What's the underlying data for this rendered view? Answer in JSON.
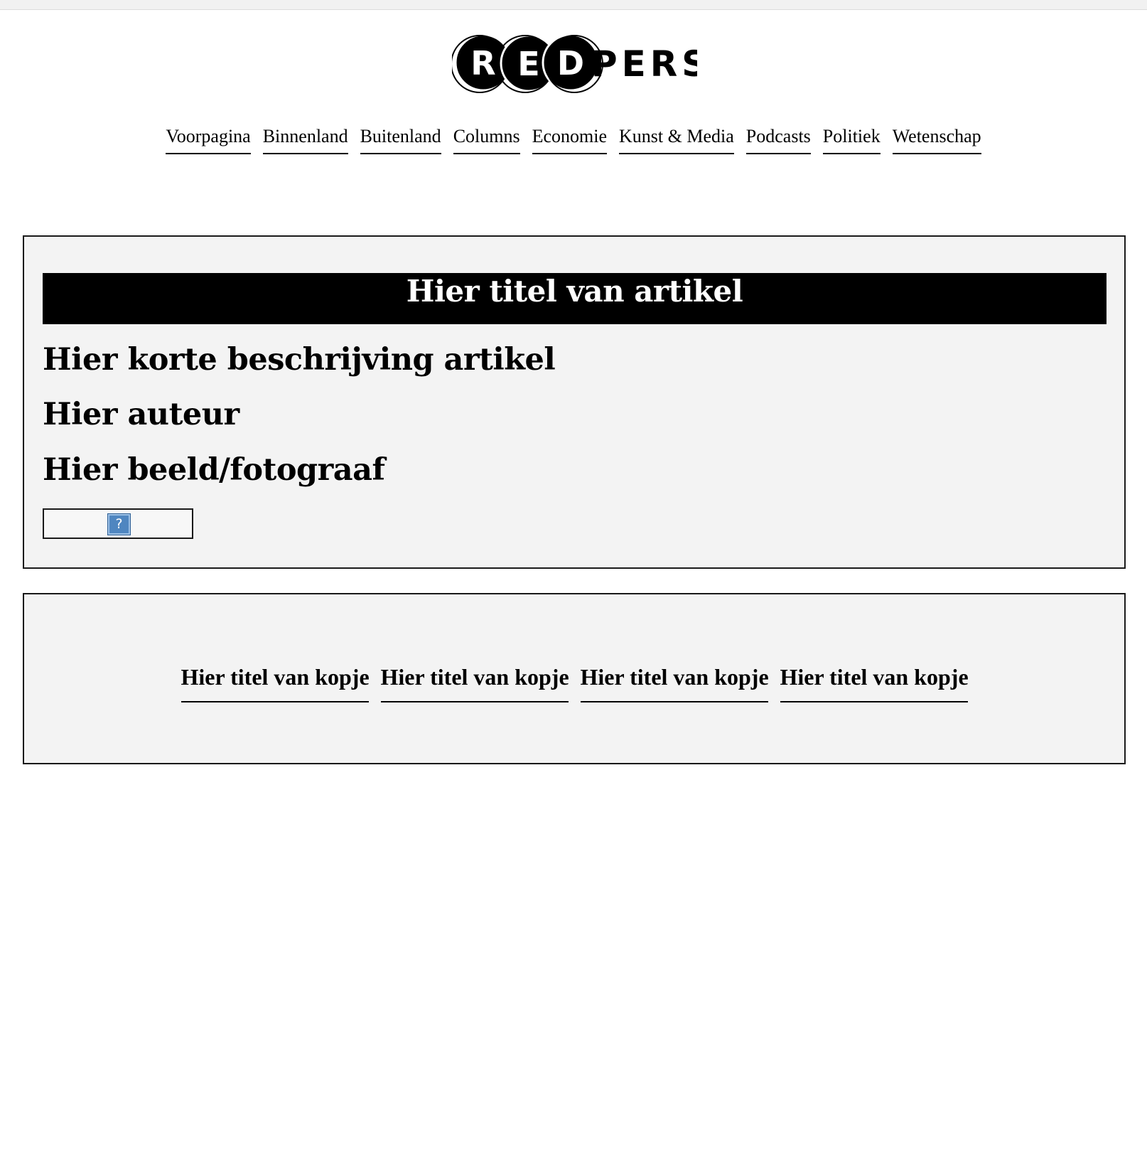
{
  "logo": {
    "letters_in_circles": [
      "R",
      "E",
      "D"
    ],
    "letters_plain": "PERS",
    "icon": "redpers-logo"
  },
  "nav": {
    "items": [
      {
        "label": "Voorpagina"
      },
      {
        "label": "Binnenland"
      },
      {
        "label": "Buitenland"
      },
      {
        "label": "Columns"
      },
      {
        "label": "Economie"
      },
      {
        "label": "Kunst & Media"
      },
      {
        "label": "Podcasts"
      },
      {
        "label": "Politiek"
      },
      {
        "label": "Wetenschap"
      }
    ]
  },
  "article": {
    "title": "Hier titel van artikel",
    "description": "Hier korte beschrijving artikel",
    "author": "Hier auteur",
    "photo_credit": "Hier beeld/fotograaf",
    "image": {
      "icon": "broken-image-icon",
      "glyph": "?"
    }
  },
  "related": {
    "items": [
      {
        "label": "Hier titel van kopje"
      },
      {
        "label": "Hier titel van kopje"
      },
      {
        "label": "Hier titel van kopje"
      },
      {
        "label": "Hier titel van kopje"
      }
    ]
  },
  "colors": {
    "background": "#ffffff",
    "panel": "#f3f3f3",
    "title_bar": "#000000",
    "text": "#000000"
  }
}
